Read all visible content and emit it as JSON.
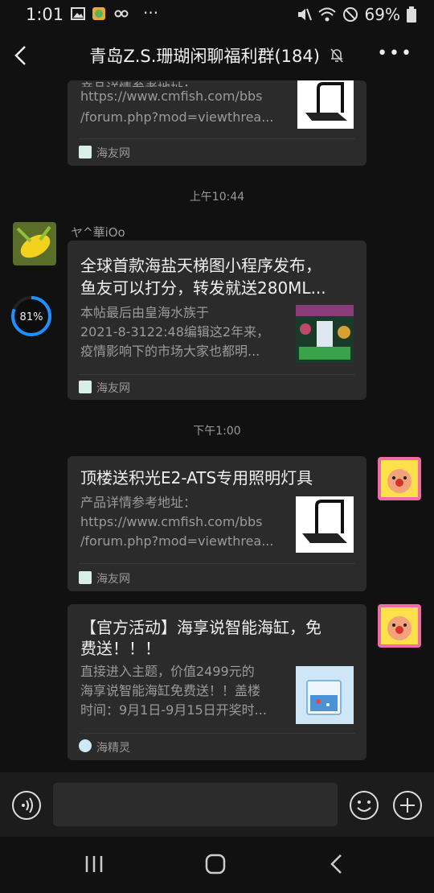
{
  "status": {
    "time": "1:01",
    "battery": "69%"
  },
  "header": {
    "title": "青岛Z.S.珊瑚闲聊福利群(184)"
  },
  "messages": [
    {
      "partial_title": "产品详情参考地址：",
      "desc1": "https://www.cmfish.com/bbs",
      "desc2": "/forum.php?mod=viewthrea...",
      "source": "海友网"
    },
    {
      "time": "上午10:44",
      "sender": "ヤ^華iOo",
      "title1": "全球首款海盐天梯图小程序发布，",
      "title2": "鱼友可以打分，转发就送280ML...",
      "desc1": "本帖最后由皇海水族于",
      "desc2": "2021-8-3122:48编辑这2年来，",
      "desc3": "疫情影响下的市场大家也都明...",
      "source": "海友网",
      "progress_label": "81%",
      "progress": 0.81
    },
    {
      "time": "下午1:00",
      "title1": "顶楼送积光E2-ATS专用照明灯具",
      "desc1": "产品详情参考地址：",
      "desc2": "https://www.cmfish.com/bbs",
      "desc3": "/forum.php?mod=viewthrea...",
      "source": "海友网"
    },
    {
      "title1": "【官方活动】海享说智能海缸，免",
      "title2": "费送！！！",
      "desc1": "直接进入主题，价值2499元的",
      "desc2": "海享说智能海缸免费送！！盖楼",
      "desc3": "时间：9月1日-9月15日开奖时...",
      "source": "海精灵"
    }
  ],
  "colors": {
    "bg": "#111111",
    "card": "#2b2b2b",
    "progress": "#1e90ff"
  }
}
